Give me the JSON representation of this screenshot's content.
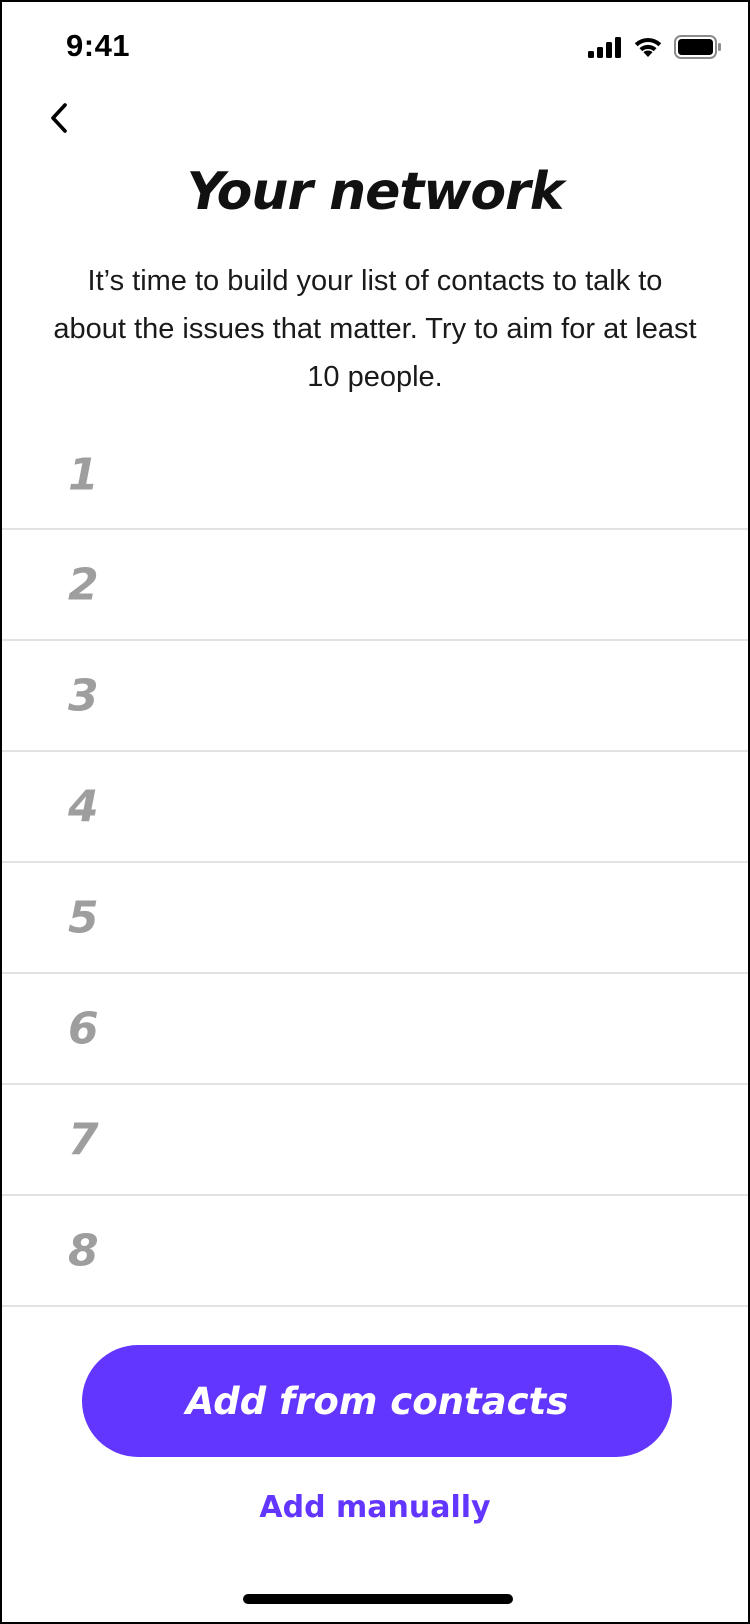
{
  "status_bar": {
    "time": "9:41",
    "icons": [
      "cellular-signal-icon",
      "wifi-icon",
      "battery-icon"
    ]
  },
  "nav": {
    "back_icon": "chevron-left-icon"
  },
  "header": {
    "title": "Your network",
    "description": "It’s time to build your list of contacts to talk to about the issues that matter. Try to aim for at least 10 people."
  },
  "contacts": {
    "slots": [
      "1",
      "2",
      "3",
      "4",
      "5",
      "6",
      "7",
      "8"
    ]
  },
  "actions": {
    "add_from_contacts_label": "Add from contacts",
    "add_manually_label": "Add manually"
  },
  "colors": {
    "accent": "#6236ff",
    "placeholder_number": "#9e9e9e",
    "divider": "#e2e2e2"
  }
}
